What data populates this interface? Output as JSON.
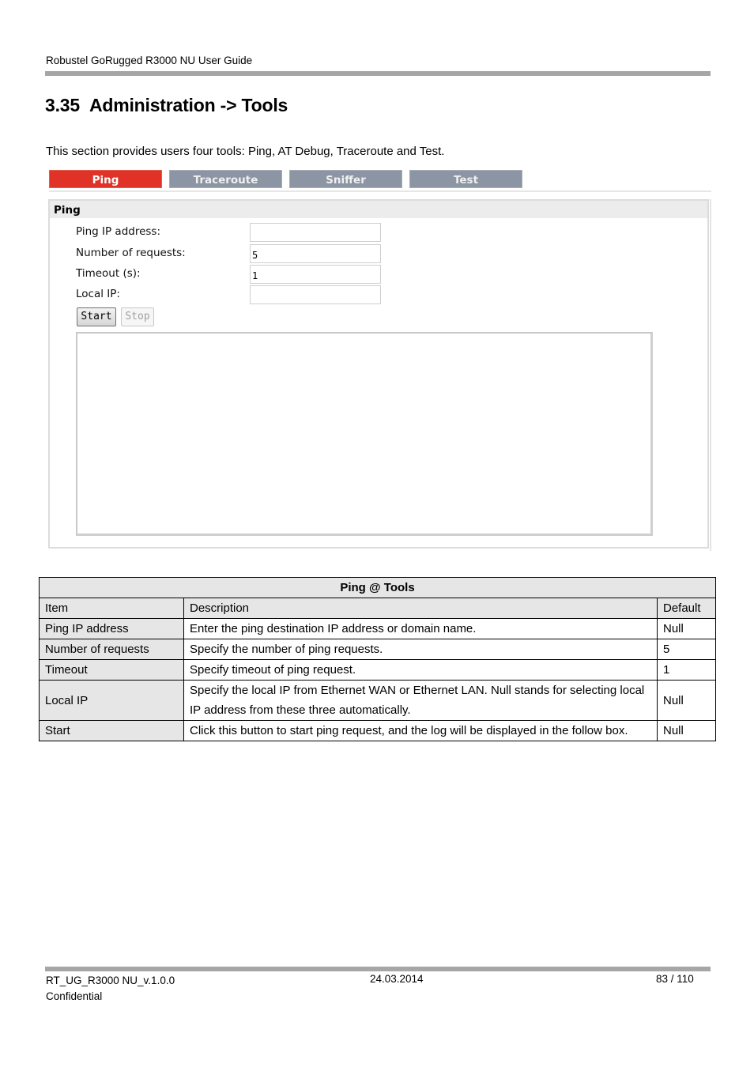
{
  "header": {
    "title": "Robustel GoRugged R3000 NU User Guide"
  },
  "section": {
    "number": "3.35",
    "title": "Administration -> Tools",
    "intro": "This section provides users four tools: Ping, AT Debug, Traceroute and Test."
  },
  "screenshot": {
    "tabs": [
      {
        "label": "Ping",
        "active": true
      },
      {
        "label": "Traceroute",
        "active": false
      },
      {
        "label": "Sniffer",
        "active": false
      },
      {
        "label": "Test",
        "active": false
      }
    ],
    "panel_title": "Ping",
    "fields": [
      {
        "label": "Ping IP address:",
        "value": ""
      },
      {
        "label": "Number of requests:",
        "value": "5"
      },
      {
        "label": "Timeout (s):",
        "value": "1"
      },
      {
        "label": "Local IP:",
        "value": ""
      }
    ],
    "buttons": {
      "start": "Start",
      "stop": "Stop"
    },
    "log": ""
  },
  "table": {
    "caption": "Ping @ Tools",
    "columns": [
      "Item",
      "Description",
      "Default"
    ],
    "rows": [
      {
        "item": "Ping IP address",
        "description": "Enter the ping destination IP address or domain name.",
        "default": "Null"
      },
      {
        "item": "Number of requests",
        "description": "Specify the number of ping requests.",
        "default": "5"
      },
      {
        "item": "Timeout",
        "description": "Specify timeout of ping request.",
        "default": "1"
      },
      {
        "item": "Local IP",
        "description": "Specify the local IP from Ethernet WAN or Ethernet LAN. Null stands for selecting local IP address from these three automatically.",
        "default": "Null"
      },
      {
        "item": "Start",
        "description": "Click this button to start ping request, and the log will be displayed in the follow box.",
        "default": "Null"
      }
    ]
  },
  "footer": {
    "doc_id": "RT_UG_R3000 NU_v.1.0.0",
    "classification": "Confidential",
    "date": "24.03.2014",
    "page": "83 / 110"
  },
  "colors": {
    "active_tab": "#e03226",
    "inactive_tab": "#8c95a3",
    "rule": "#a6a6a6",
    "table_shade": "#e6e6e6"
  }
}
